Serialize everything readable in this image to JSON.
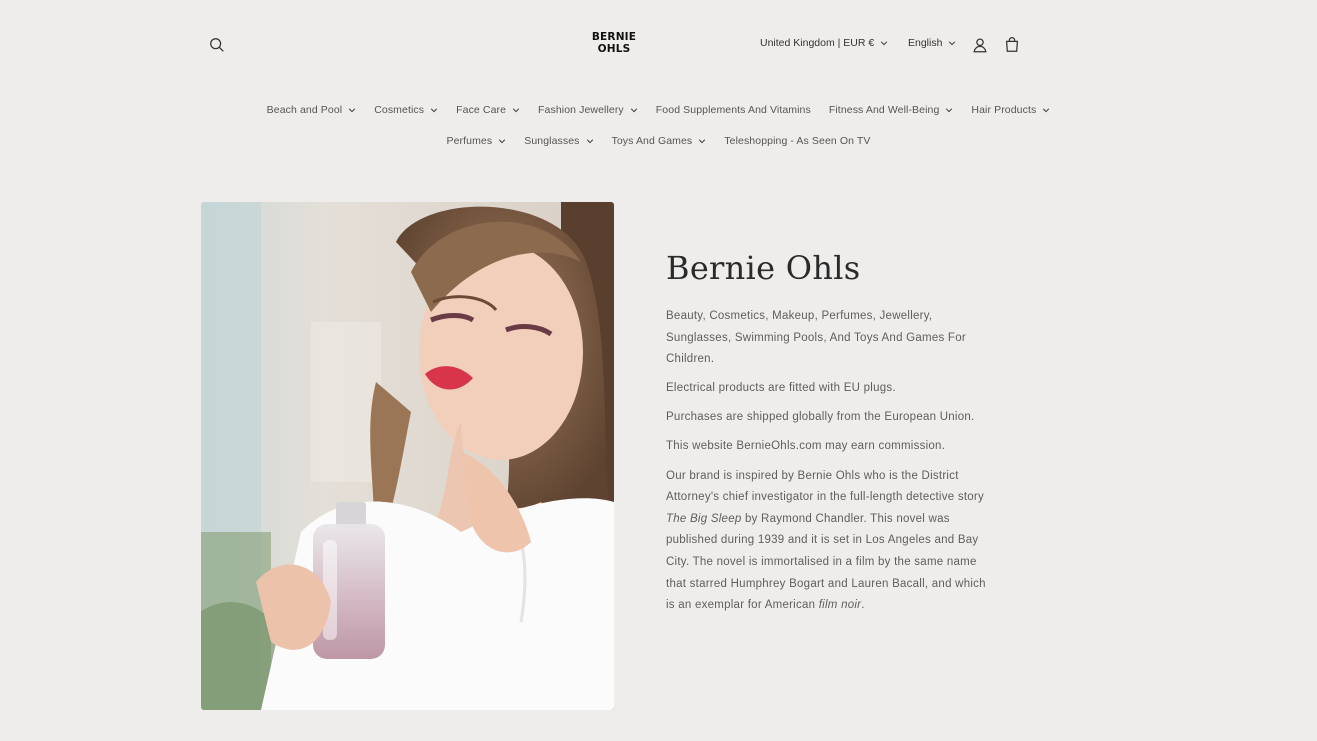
{
  "header": {
    "logo_line1": "BERNIE",
    "logo_line2": "OHLS",
    "country_selector": "United Kingdom | EUR €",
    "language_selector": "English",
    "icons": [
      "search-icon",
      "account-icon",
      "cart-icon"
    ]
  },
  "nav": {
    "row1": [
      {
        "label": "Beach and Pool",
        "dropdown": true
      },
      {
        "label": "Cosmetics",
        "dropdown": true
      },
      {
        "label": "Face Care",
        "dropdown": true
      },
      {
        "label": "Fashion Jewellery",
        "dropdown": true
      },
      {
        "label": "Food Supplements And Vitamins",
        "dropdown": false
      },
      {
        "label": "Fitness And Well-Being",
        "dropdown": true
      },
      {
        "label": "Hair Products",
        "dropdown": true
      }
    ],
    "row2": [
      {
        "label": "Perfumes",
        "dropdown": true
      },
      {
        "label": "Sunglasses",
        "dropdown": true
      },
      {
        "label": "Toys And Games",
        "dropdown": true
      },
      {
        "label": "Teleshopping - As Seen On TV",
        "dropdown": false
      }
    ]
  },
  "main": {
    "title": "Bernie Ohls",
    "p1": "Beauty, Cosmetics, Makeup, Perfumes, Jewellery, Sunglasses, Swimming Pools, And Toys And Games For Children.",
    "p2": "Electrical products are fitted with EU plugs.",
    "p3": "Purchases are shipped globally from the European Union.",
    "p4": "This website BernieOhls.com may earn commission.",
    "p5_a": "Our brand is inspired by Bernie Ohls who is the District Attorney's chief investigator in the full-length detective story ",
    "p5_italic1": "The Big Sleep",
    "p5_b": " by Raymond Chandler. This novel was published during 1939 and it is set in Los Angeles and Bay City. The novel is immortalised in a film by the same name that starred Humphrey Bogart and Lauren Bacall, and which is an exemplar for American ",
    "p5_italic2": "film noir",
    "p5_c": "."
  },
  "colors": {
    "background": "#efedeb",
    "text": "#5e5e5e",
    "heading": "#2a2a2a"
  }
}
